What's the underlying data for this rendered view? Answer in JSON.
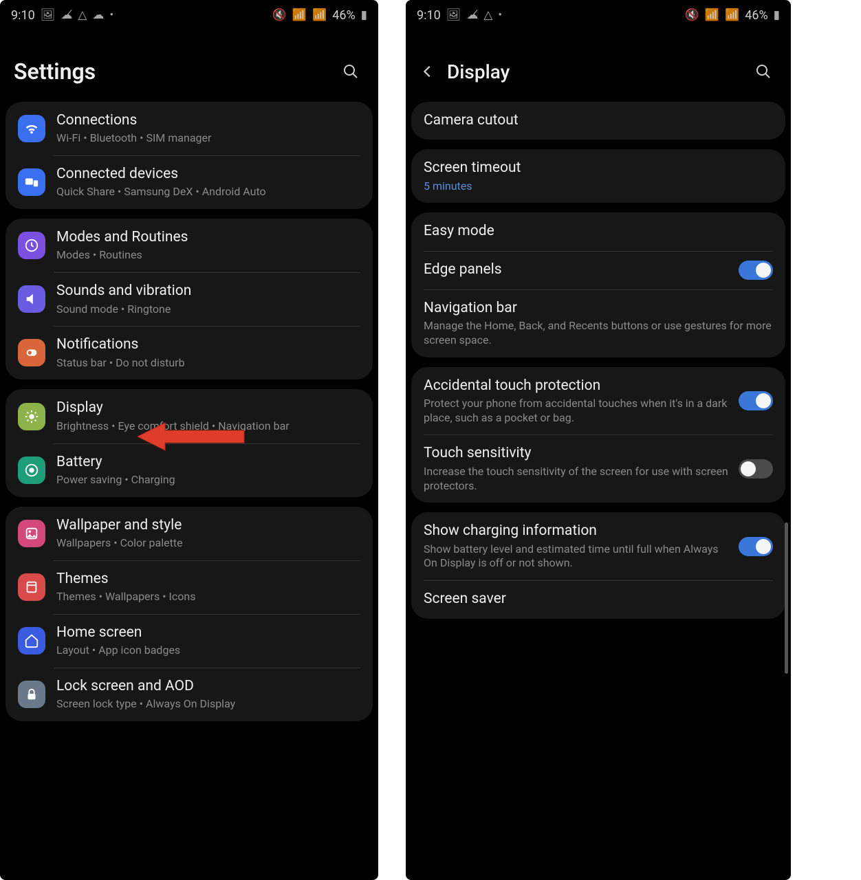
{
  "status": {
    "time": "9:10",
    "battery": "46%"
  },
  "left": {
    "title": "Settings",
    "groups": [
      [
        {
          "id": "connections",
          "icon": "wifi-icon",
          "bg": "bg-blue",
          "title": "Connections",
          "sub": "Wi-Fi  •  Bluetooth  •  SIM manager"
        },
        {
          "id": "connected-devices",
          "icon": "devices-icon",
          "bg": "bg-blue2",
          "title": "Connected devices",
          "sub": "Quick Share  •  Samsung DeX  •  Android Auto"
        }
      ],
      [
        {
          "id": "modes-routines",
          "icon": "routine-icon",
          "bg": "bg-purple",
          "title": "Modes and Routines",
          "sub": "Modes  •  Routines"
        },
        {
          "id": "sounds",
          "icon": "sound-icon",
          "bg": "bg-violet",
          "title": "Sounds and vibration",
          "sub": "Sound mode  •  Ringtone"
        },
        {
          "id": "notifications",
          "icon": "bell-icon",
          "bg": "bg-orange",
          "title": "Notifications",
          "sub": "Status bar  •  Do not disturb"
        }
      ],
      [
        {
          "id": "display",
          "icon": "brightness-icon",
          "bg": "bg-green",
          "title": "Display",
          "sub": "Brightness  •  Eye comfort shield  •  Navigation bar"
        },
        {
          "id": "battery",
          "icon": "battery-icon",
          "bg": "bg-teal",
          "title": "Battery",
          "sub": "Power saving  •  Charging"
        }
      ],
      [
        {
          "id": "wallpaper",
          "icon": "wallpaper-icon",
          "bg": "bg-pink",
          "title": "Wallpaper and style",
          "sub": "Wallpapers  •  Color palette"
        },
        {
          "id": "themes",
          "icon": "themes-icon",
          "bg": "bg-red",
          "title": "Themes",
          "sub": "Themes  •  Wallpapers  •  Icons"
        },
        {
          "id": "home-screen",
          "icon": "home-icon",
          "bg": "bg-navy",
          "title": "Home screen",
          "sub": "Layout  •  App icon badges"
        },
        {
          "id": "lock-screen",
          "icon": "lock-icon",
          "bg": "bg-grey",
          "title": "Lock screen and AOD",
          "sub": "Screen lock type  •  Always On Display"
        }
      ]
    ]
  },
  "right": {
    "title": "Display",
    "groups": [
      [
        {
          "id": "camera-cutout",
          "title": "Camera cutout",
          "sub": ""
        }
      ],
      [
        {
          "id": "screen-timeout",
          "title": "Screen timeout",
          "sub": "5 minutes",
          "subClass": "blue"
        }
      ],
      [
        {
          "id": "easy-mode",
          "title": "Easy mode",
          "sub": ""
        },
        {
          "id": "edge-panels",
          "title": "Edge panels",
          "sub": "",
          "toggle": true
        },
        {
          "id": "navigation-bar",
          "title": "Navigation bar",
          "sub": "Manage the Home, Back, and Recents buttons or use gestures for more screen space."
        }
      ],
      [
        {
          "id": "accidental-touch",
          "title": "Accidental touch protection",
          "sub": "Protect your phone from accidental touches when it's in a dark place, such as a pocket or bag.",
          "toggle": true
        },
        {
          "id": "touch-sensitivity",
          "title": "Touch sensitivity",
          "sub": "Increase the touch sensitivity of the screen for use with screen protectors.",
          "toggle": false
        }
      ],
      [
        {
          "id": "charging-info",
          "title": "Show charging information",
          "sub": "Show battery level and estimated time until full when Always On Display is off or not shown.",
          "toggle": true
        },
        {
          "id": "screen-saver",
          "title": "Screen saver",
          "sub": ""
        }
      ]
    ]
  }
}
